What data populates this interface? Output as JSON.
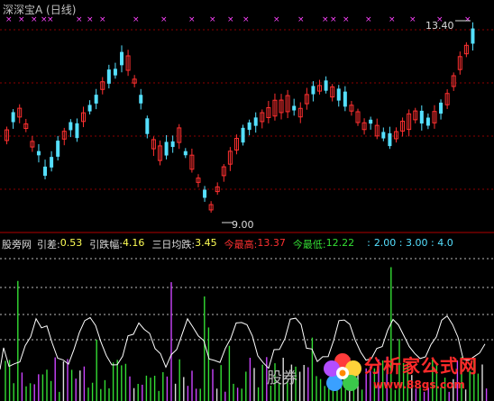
{
  "title": "深深宝A (日线)",
  "price_annotations": {
    "high": "13.40",
    "low": "9.00"
  },
  "indicator": {
    "name": "股旁网",
    "items": [
      {
        "label": "引差:",
        "value": "0.53",
        "label_color": "white",
        "value_color": "yellow"
      },
      {
        "label": "引跌幅:",
        "value": "4.16",
        "label_color": "white",
        "value_color": "yellow"
      },
      {
        "label": "三日均跌:",
        "value": "3.45",
        "label_color": "white",
        "value_color": "yellow"
      },
      {
        "label": "今最高:",
        "value": "13.37",
        "label_color": "red",
        "value_color": "red"
      },
      {
        "label": "今最低:",
        "value": "12.22",
        "label_color": "green",
        "value_color": "green"
      },
      {
        "label": ":",
        "value": "2.00 : 3.00 : 4.0",
        "label_color": "cyan",
        "value_color": "cyan"
      }
    ]
  },
  "watermark": {
    "text": "股券",
    "logo_title": "分析家公式网",
    "logo_url": "www.88gs.com"
  },
  "colors": {
    "up": "#ff3030",
    "down": "#55e0ff",
    "grid": "#8b0000",
    "marker": "#ff44ff"
  }
}
